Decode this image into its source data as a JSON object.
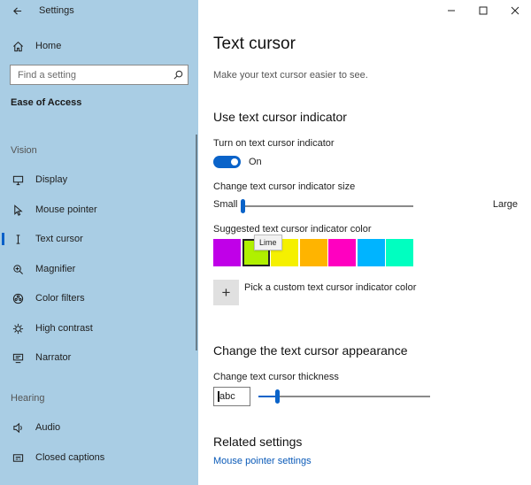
{
  "window": {
    "title": "Settings",
    "minimize_icon": "minimize-icon",
    "maximize_icon": "maximize-icon",
    "close_icon": "close-icon"
  },
  "sidebar": {
    "home_label": "Home",
    "search_placeholder": "Find a setting",
    "section_title": "Ease of Access",
    "groups": [
      {
        "label": "Vision",
        "items": [
          {
            "label": "Display",
            "icon": "monitor-icon"
          },
          {
            "label": "Mouse pointer",
            "icon": "mouse-pointer-icon"
          },
          {
            "label": "Text cursor",
            "icon": "text-cursor-icon",
            "selected": true
          },
          {
            "label": "Magnifier",
            "icon": "magnifier-icon"
          },
          {
            "label": "Color filters",
            "icon": "color-filters-icon"
          },
          {
            "label": "High contrast",
            "icon": "high-contrast-icon"
          },
          {
            "label": "Narrator",
            "icon": "narrator-icon"
          }
        ]
      },
      {
        "label": "Hearing",
        "items": [
          {
            "label": "Audio",
            "icon": "speaker-icon"
          },
          {
            "label": "Closed captions",
            "icon": "closed-captions-icon"
          }
        ]
      }
    ]
  },
  "main": {
    "title": "Text cursor",
    "subtitle": "Make your text cursor easier to see.",
    "indicator_section": {
      "heading": "Use text cursor indicator",
      "toggle_label": "Turn on text cursor indicator",
      "toggle_state": "On",
      "toggle_on": true,
      "size_label": "Change text cursor indicator size",
      "size_min_label": "Small",
      "size_max_label": "Large",
      "size_value_fraction": 0.0,
      "color_label": "Suggested text cursor indicator color",
      "colors": [
        {
          "name": "Purple",
          "hex": "#c000e8"
        },
        {
          "name": "Lime",
          "hex": "#b0f000",
          "selected": true
        },
        {
          "name": "Yellow",
          "hex": "#f5f000"
        },
        {
          "name": "Gold",
          "hex": "#ffb400"
        },
        {
          "name": "Magenta",
          "hex": "#ff00c0"
        },
        {
          "name": "Sky blue",
          "hex": "#00b4ff"
        },
        {
          "name": "Spring green",
          "hex": "#00ffc0"
        }
      ],
      "tooltip": "Lime",
      "custom_color_label": "Pick a custom text cursor indicator color"
    },
    "appearance_section": {
      "heading": "Change the text cursor appearance",
      "thickness_label": "Change text cursor thickness",
      "preview_text": "abc",
      "thickness_value_fraction": 0.05
    },
    "related_section": {
      "heading": "Related settings",
      "link": "Mouse pointer settings"
    }
  },
  "colors": {
    "sidebar_bg": "#a9cde4",
    "accent": "#0a63c9"
  }
}
